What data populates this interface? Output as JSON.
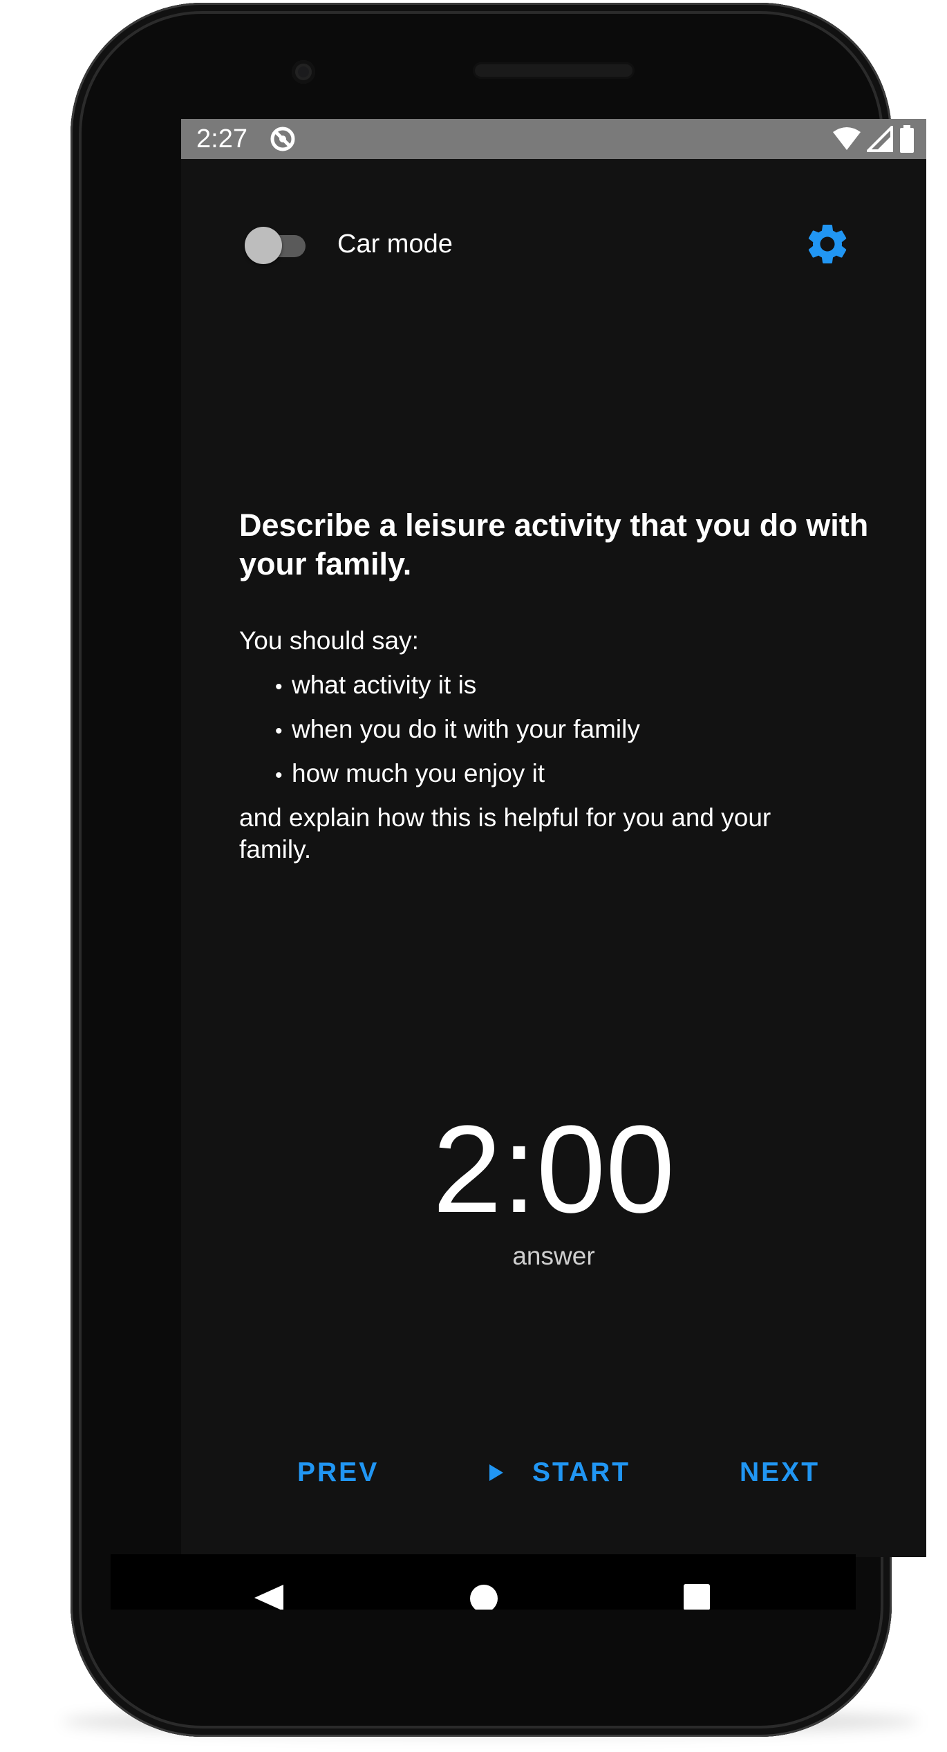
{
  "status_bar": {
    "time": "2:27",
    "app_icon": "app-notification-icon",
    "icons": [
      "wifi-icon",
      "signal-icon",
      "battery-icon"
    ]
  },
  "header": {
    "car_mode_label": "Car mode",
    "car_mode_on": false,
    "settings_icon": "gear-icon"
  },
  "prompt": {
    "question": "Describe a leisure activity that you do with your family.",
    "intro": "You should say:",
    "bullets": [
      "what activity it is",
      "when you do it with your family",
      "how much you enjoy it"
    ],
    "outro": "and explain how this is helpful for you and your family."
  },
  "timer": {
    "value": "2:00",
    "label": "answer"
  },
  "controls": {
    "prev_label": "PREV",
    "start_label": "START",
    "next_label": "NEXT"
  },
  "navigation": {
    "icons": [
      "back-icon",
      "home-icon",
      "recents-icon"
    ]
  },
  "colors": {
    "accent": "#2196f3",
    "background": "#121212",
    "status_bar": "#7a7a7a"
  }
}
